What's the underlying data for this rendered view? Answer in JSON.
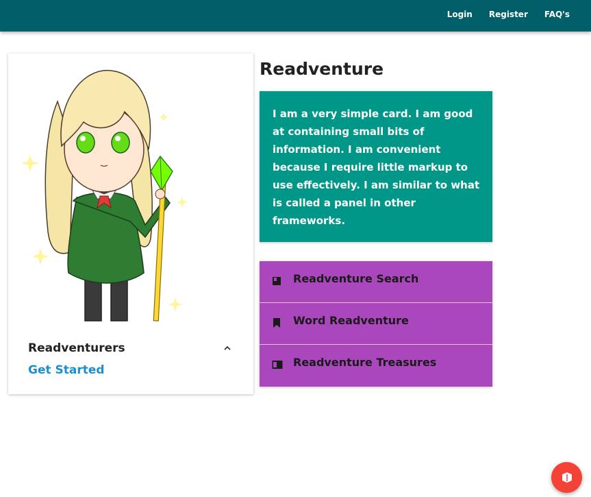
{
  "nav": {
    "login": "Login",
    "register": "Register",
    "faq": "FAQ's"
  },
  "profile_card": {
    "title": "Readventurers",
    "link": "Get Started"
  },
  "main": {
    "heading": "Readventure",
    "card_text": "I am a very simple card. I am good at containing small bits of information. I am convenient because I require little markup to use effectively. I am similar to what is called a panel in other frameworks."
  },
  "menu": {
    "items": [
      {
        "label": "Readventure Search",
        "icon": "book-icon"
      },
      {
        "label": "Word Readventure",
        "icon": "bookmark-icon"
      },
      {
        "label": "Readventure Treasures",
        "icon": "chrome-reader-mode-icon"
      }
    ]
  },
  "fab": {
    "icon": "chrome-reader-mode-icon"
  },
  "colors": {
    "navbar": "#005f68",
    "teal_card": "#009688",
    "menu": "#ab47bc",
    "link": "#1c8fce",
    "fab": "#f44336"
  }
}
